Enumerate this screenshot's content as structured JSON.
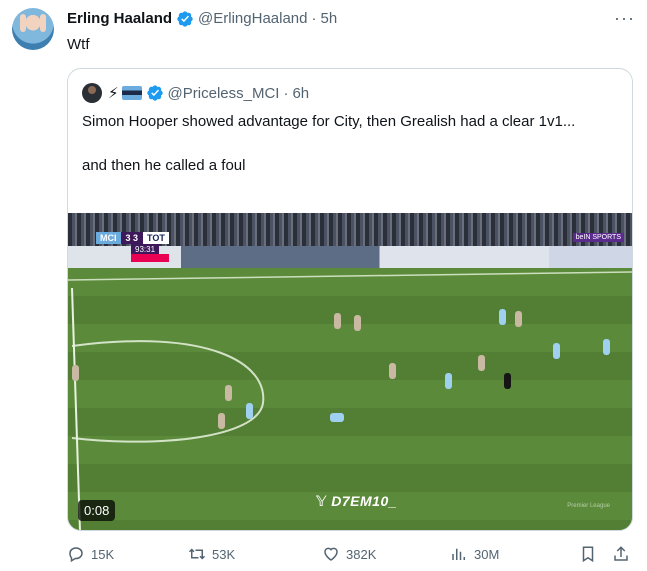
{
  "tweet": {
    "author_name": "Erling Haaland",
    "author_handle": "@ErlingHaaland",
    "separator": "·",
    "time": "5h",
    "text": "Wtf",
    "more_icon": "more-horizontal-icon"
  },
  "quoted": {
    "emoji": "⚡",
    "handle": "@Priceless_MCI",
    "separator": "·",
    "time": "6h",
    "paragraph1": "Simon Hooper showed advantage for City, then Grealish had a clear 1v1...",
    "paragraph2": "and then he called a foul",
    "video": {
      "duration": "0:08",
      "watermark": "𝕐 D7EM10_",
      "scorebug": {
        "home": "MCI",
        "score": "3 3",
        "away": "TOT",
        "clock": "93:31"
      },
      "broadcaster": "beIN SPORTS",
      "pl_mark": "Premier League"
    }
  },
  "actions": {
    "replies": "15K",
    "reposts": "53K",
    "likes": "382K",
    "views": "30M"
  },
  "colors": {
    "verified": "#1d9bf0",
    "muted": "#536471",
    "border": "#cfd9de",
    "text": "#0f1419"
  }
}
